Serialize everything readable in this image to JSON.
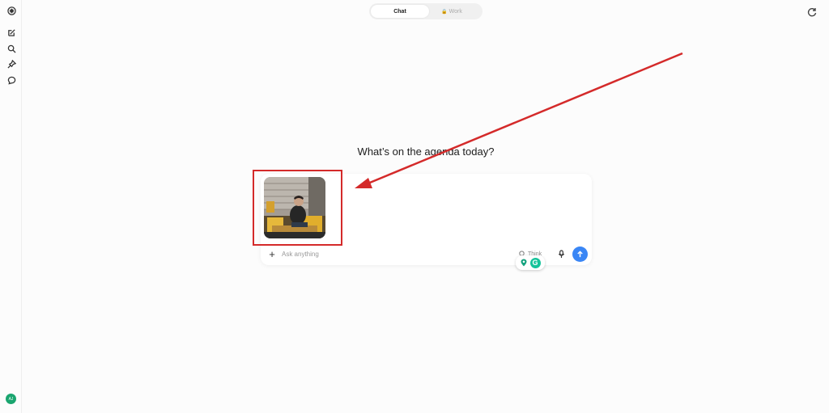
{
  "sidebar": {
    "items": [
      {
        "icon": "logo-icon"
      },
      {
        "icon": "new-chat-icon"
      },
      {
        "icon": "search-icon"
      },
      {
        "icon": "pin-icon"
      },
      {
        "icon": "chat-bubble-icon"
      }
    ],
    "avatar_initials": "AJ"
  },
  "mode_toggle": {
    "active": "Chat",
    "inactive": "Work"
  },
  "main": {
    "headline": "What’s on the agenda today?"
  },
  "composer": {
    "placeholder": "Ask anything",
    "think_label": "Think",
    "attachment": "image-attachment"
  },
  "annotation": {
    "color": "#d42a2a"
  },
  "colors": {
    "send_button": "#3a86f5",
    "grammarly": "#15c39a",
    "avatar": "#1aa56f"
  }
}
